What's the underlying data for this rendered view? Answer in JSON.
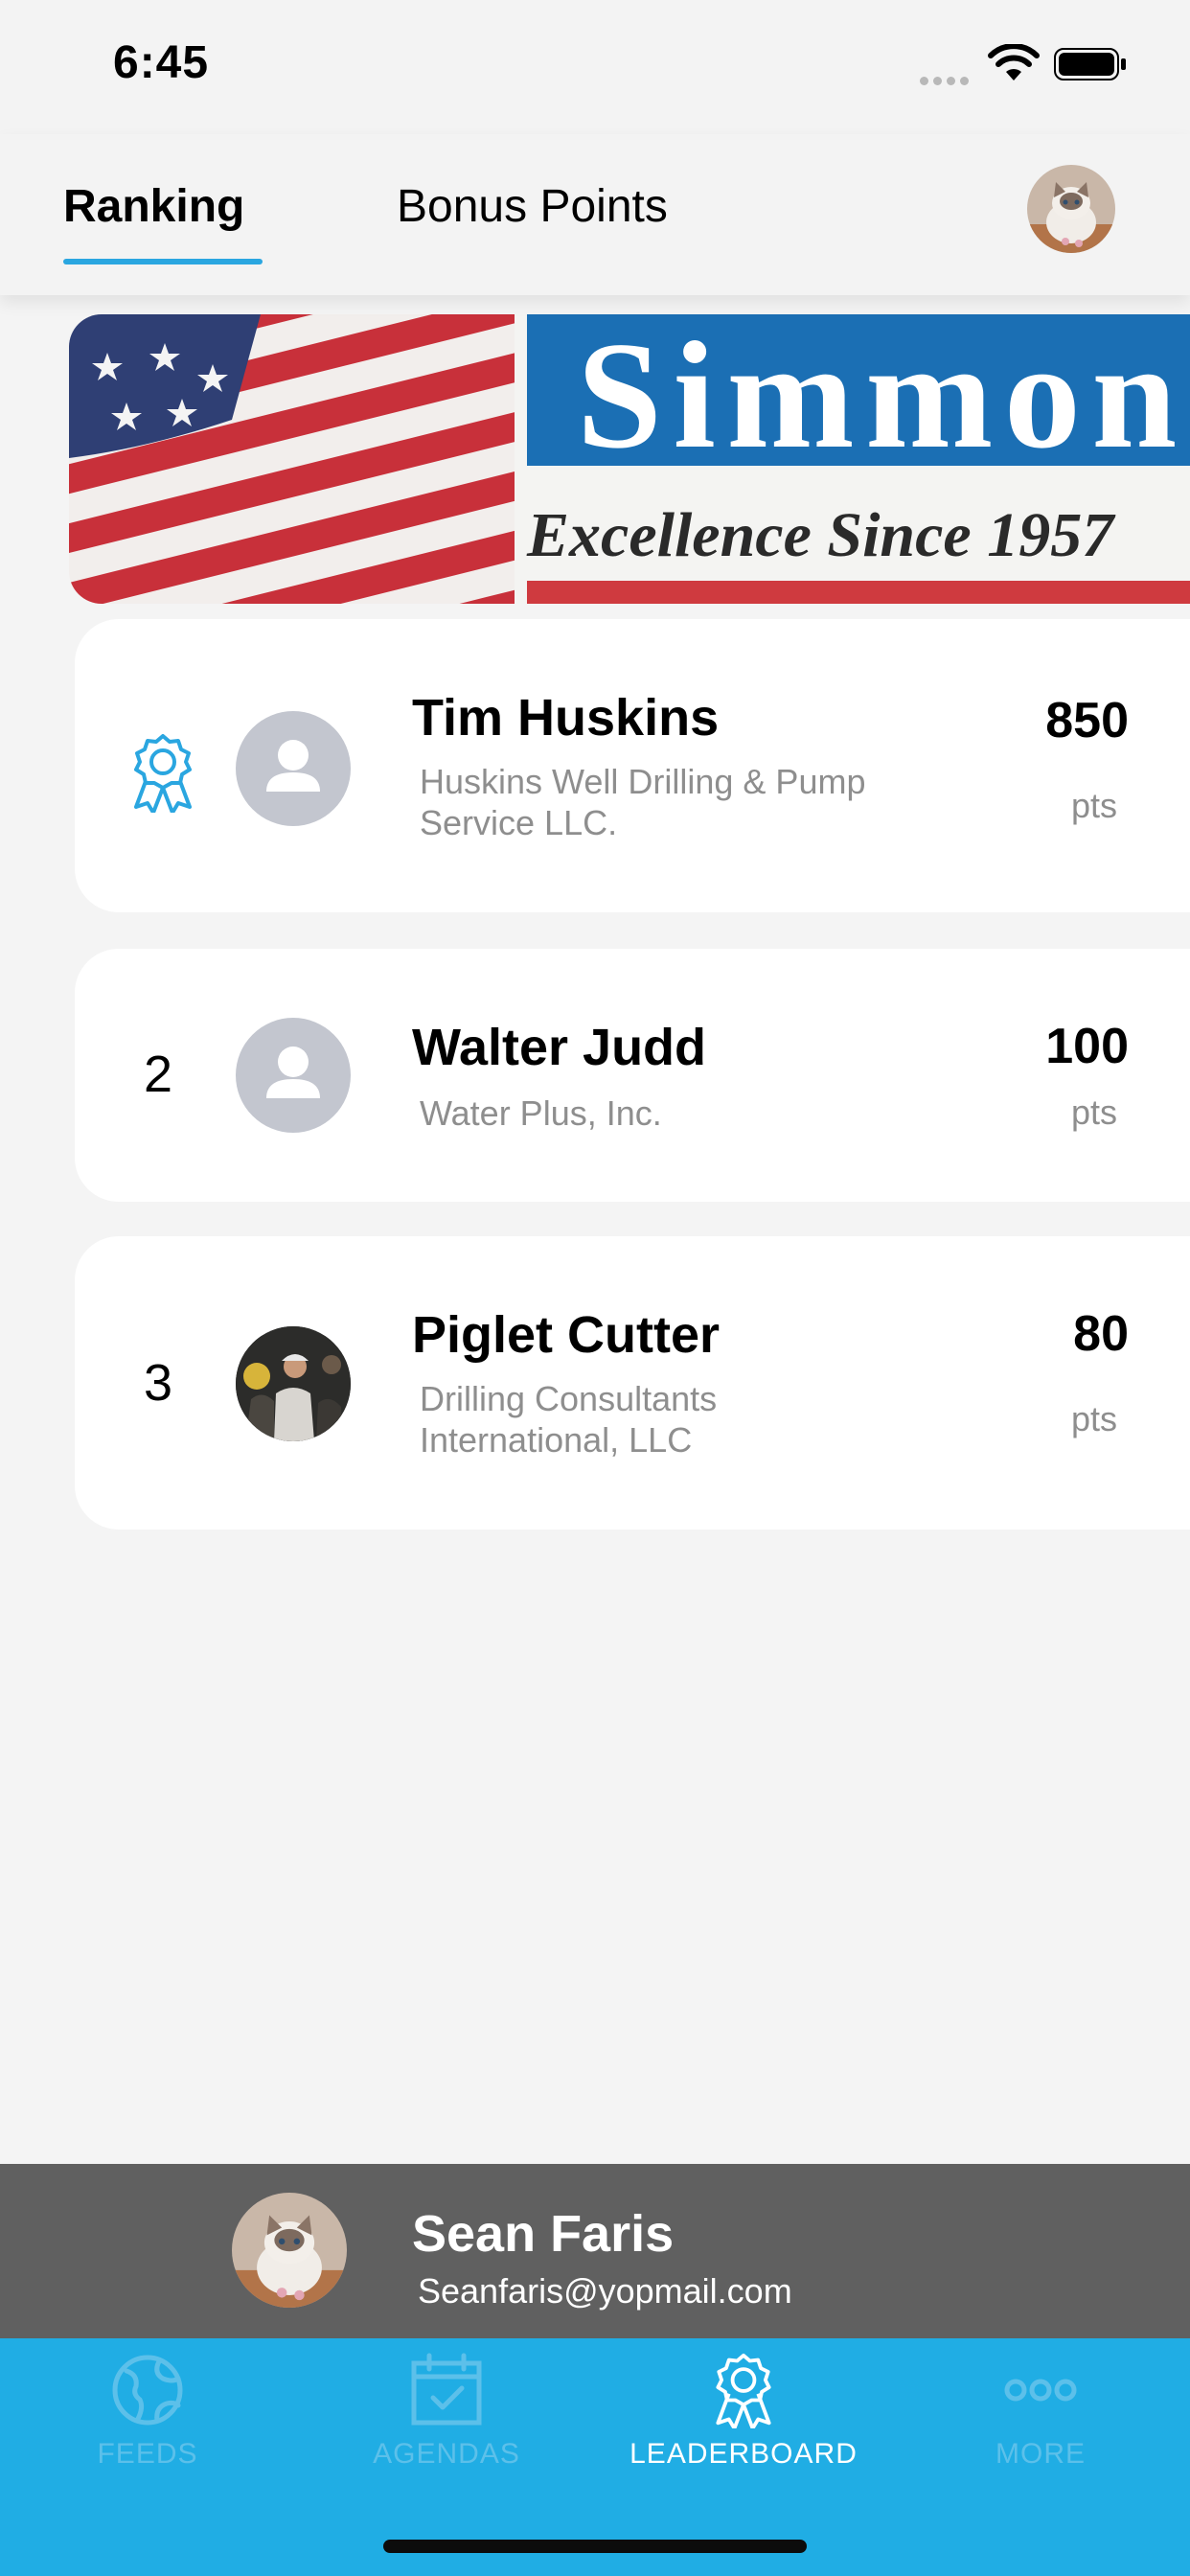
{
  "status_bar": {
    "time": "6:45"
  },
  "header": {
    "tabs": [
      {
        "label": "Ranking",
        "active": true
      },
      {
        "label": "Bonus Points",
        "active": false
      }
    ]
  },
  "banner": {
    "brand": "Simmons",
    "tagline": "Excellence Since 1957"
  },
  "leaderboard": [
    {
      "rank": "1",
      "rank_icon": "award-badge-icon",
      "name": "Tim Huskins",
      "company_line1": "Huskins Well Drilling & Pump",
      "company_line2": "Service LLC.",
      "points": "850",
      "unit": "pts",
      "avatar": "default-user"
    },
    {
      "rank": "2",
      "name": "Walter Judd",
      "company_line1": "Water Plus, Inc.",
      "company_line2": "",
      "points": "100",
      "unit": "pts",
      "avatar": "default-user"
    },
    {
      "rank": "3",
      "name": "Piglet Cutter",
      "company_line1": "Drilling Consultants",
      "company_line2": "International, LLC",
      "points": "80",
      "unit": "pts",
      "avatar": "photo"
    }
  ],
  "current_user": {
    "name": "Sean Faris",
    "email": "Seanfaris@yopmail.com"
  },
  "nav": [
    {
      "label": "FEEDS",
      "icon": "globe-icon",
      "active": false
    },
    {
      "label": "AGENDAS",
      "icon": "calendar-check-icon",
      "active": false
    },
    {
      "label": "LEADERBOARD",
      "icon": "award-icon",
      "active": true
    },
    {
      "label": "MORE",
      "icon": "more-dots-icon",
      "active": false
    }
  ],
  "colors": {
    "accent": "#20ade4",
    "tab_underline": "#2aa6e0",
    "user_bar": "#606060",
    "inactive_nav": "#5cc0ea"
  }
}
